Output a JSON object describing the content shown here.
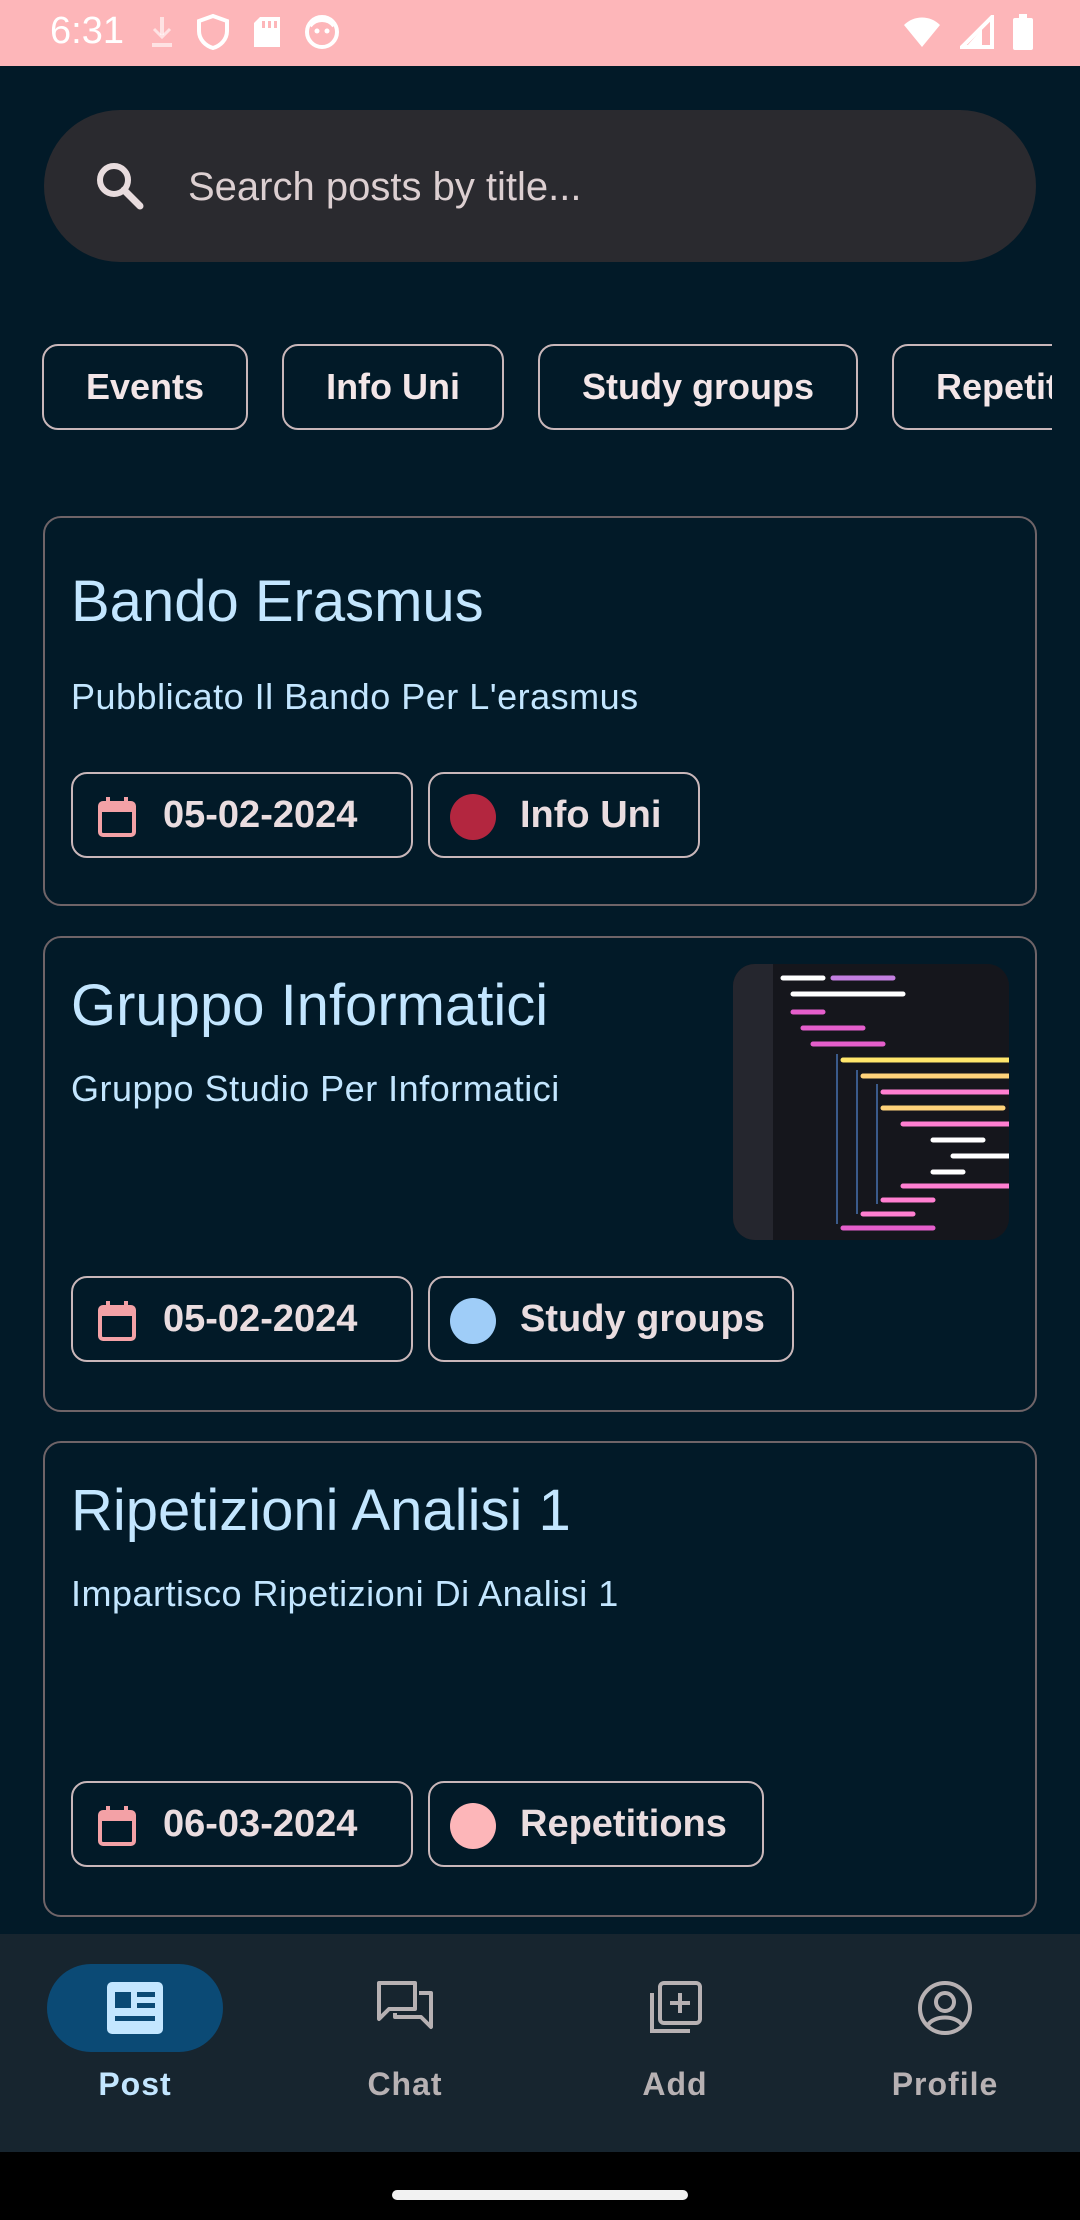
{
  "status_bar": {
    "time": "6:31",
    "left_icons": [
      "download-icon",
      "shield-icon",
      "sd-card-icon",
      "face-icon"
    ],
    "right_icons": [
      "wifi-icon",
      "signal-icon",
      "battery-icon"
    ]
  },
  "search": {
    "placeholder": "Search posts by title...",
    "icon": "search-icon"
  },
  "filters": [
    "Events",
    "Info Uni",
    "Study groups",
    "Repetitions"
  ],
  "posts": [
    {
      "title": "Bando Erasmus",
      "description": "Pubblicato Il Bando Per L'erasmus",
      "date": "05-02-2024",
      "category": "Info Uni",
      "category_color": "#b3263f",
      "has_image": false
    },
    {
      "title": "Gruppo Informatici",
      "description": "Gruppo Studio Per Informatici",
      "date": "05-02-2024",
      "category": "Study groups",
      "category_color": "#9fcdf8",
      "has_image": true,
      "image_subject": "code-screenshot"
    },
    {
      "title": "Ripetizioni Analisi 1",
      "description": "Impartisco Ripetizioni Di Analisi 1",
      "date": "06-03-2024",
      "category": "Repetitions",
      "category_color": "#fdb6b9",
      "has_image": false
    }
  ],
  "bottom_nav": [
    {
      "label": "Post",
      "icon": "article-icon",
      "active": true
    },
    {
      "label": "Chat",
      "icon": "chat-icon",
      "active": false
    },
    {
      "label": "Add",
      "icon": "add-library-icon",
      "active": false
    },
    {
      "label": "Profile",
      "icon": "account-circle-icon",
      "active": false
    }
  ],
  "colors": {
    "background": "#021a28",
    "status_bar": "#fdb6b9",
    "accent_text": "#c3e6ff",
    "nav_active": "#0b4a75",
    "date_icon": "#f3a1a6"
  }
}
